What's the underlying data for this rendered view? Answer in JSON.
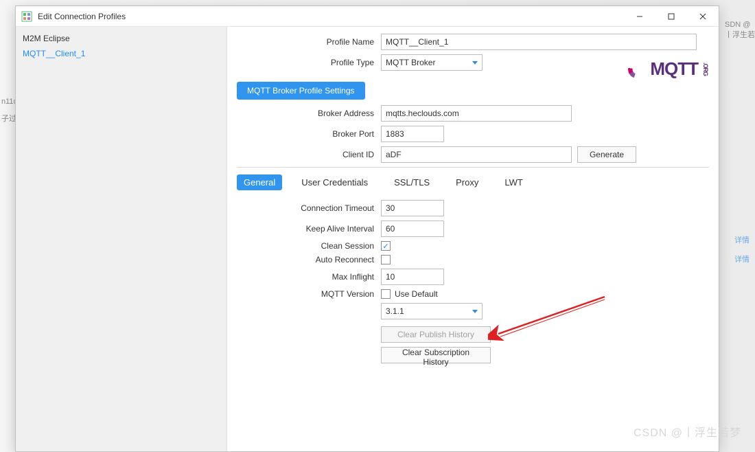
{
  "window": {
    "title": "Edit Connection Profiles"
  },
  "sidebar": {
    "items": [
      {
        "label": "M2M Eclipse"
      },
      {
        "label": "MQTT__Client_1"
      }
    ]
  },
  "logo": {
    "text": "MQTT",
    "suffix": ".ORG"
  },
  "form": {
    "profile_name_label": "Profile Name",
    "profile_name": "MQTT__Client_1",
    "profile_type_label": "Profile Type",
    "profile_type": "MQTT Broker",
    "settings_button": "MQTT Broker Profile Settings",
    "broker_address_label": "Broker Address",
    "broker_address": "mqtts.heclouds.com",
    "broker_port_label": "Broker Port",
    "broker_port": "1883",
    "client_id_label": "Client ID",
    "client_id": "aDF",
    "generate_button": "Generate"
  },
  "tabs": [
    "General",
    "User Credentials",
    "SSL/TLS",
    "Proxy",
    "LWT"
  ],
  "general": {
    "connection_timeout_label": "Connection Timeout",
    "connection_timeout": "30",
    "keep_alive_label": "Keep Alive Interval",
    "keep_alive": "60",
    "clean_session_label": "Clean Session",
    "clean_session_checked": true,
    "auto_reconnect_label": "Auto Reconnect",
    "auto_reconnect_checked": false,
    "max_inflight_label": "Max Inflight",
    "max_inflight": "10",
    "mqtt_version_label": "MQTT Version",
    "use_default_label": "Use Default",
    "use_default_checked": false,
    "version_value": "3.1.1",
    "clear_publish": "Clear Publish History",
    "clear_subscription": "Clear Subscription History"
  },
  "watermark": "CSDN @丨浮生若梦"
}
